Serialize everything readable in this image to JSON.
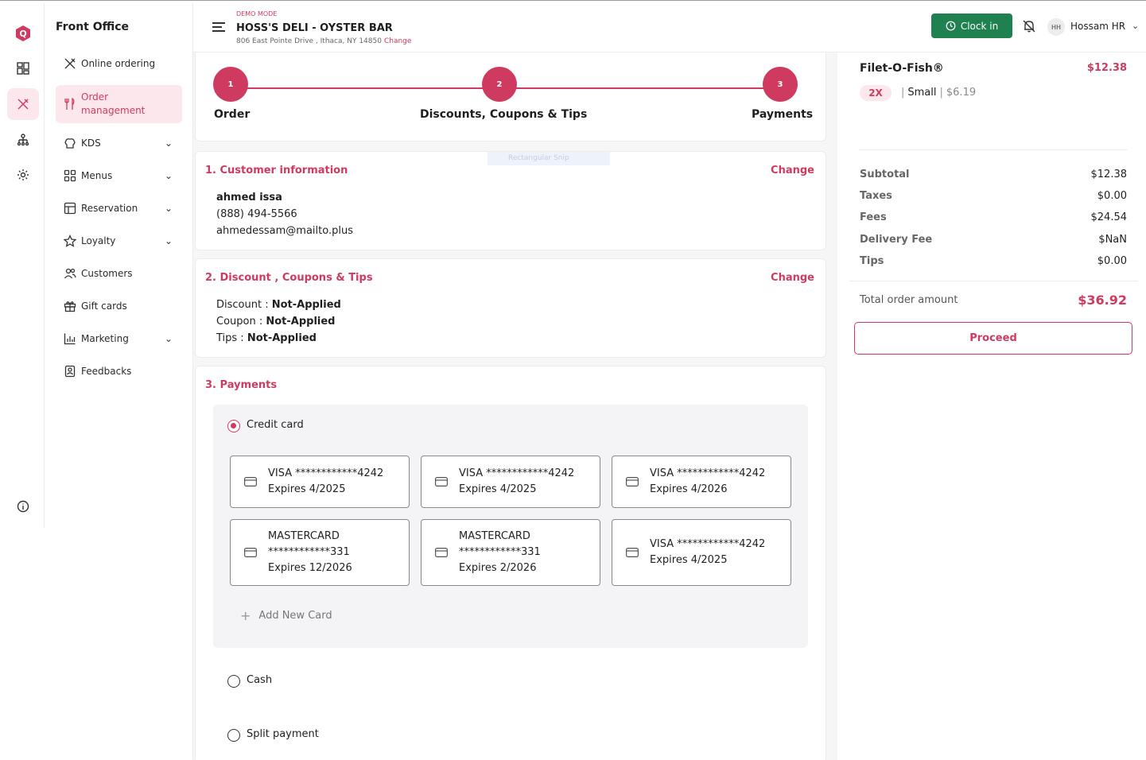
{
  "sidebar": {
    "title": "Front Office",
    "items": [
      {
        "label": "Online ordering",
        "icon": "utensils-icon"
      },
      {
        "label": "Order management",
        "icon": "fork-knife-icon"
      },
      {
        "label": "KDS",
        "icon": "chef-hat-icon"
      },
      {
        "label": "Menus",
        "icon": "grid-icon"
      },
      {
        "label": "Reservation",
        "icon": "table-icon"
      },
      {
        "label": "Loyalty",
        "icon": "star-icon"
      },
      {
        "label": "Customers",
        "icon": "users-icon"
      },
      {
        "label": "Gift cards",
        "icon": "gift-icon"
      },
      {
        "label": "Marketing",
        "icon": "chart-icon"
      },
      {
        "label": "Feedbacks",
        "icon": "feedback-icon"
      }
    ]
  },
  "header": {
    "demo_label": "DEMO MODE",
    "store_name": "HOSS'S DELI - OYSTER BAR",
    "address": "806 East Pointe Drive , Ithaca, NY 14850",
    "change_label": "Change",
    "clockin_label": "Clock in",
    "user_initials": "HH",
    "user_name": "Hossam HR"
  },
  "stepper": {
    "steps": [
      {
        "number": "1",
        "label": "Order"
      },
      {
        "number": "2",
        "label": "Discounts, Coupons & Tips"
      },
      {
        "number": "3",
        "label": "Payments"
      }
    ]
  },
  "ghost_label": "Rectangular Snip",
  "customer": {
    "title": "1. Customer information",
    "change_label": "Change",
    "name": "ahmed issa",
    "phone": "(888) 494-5566",
    "email": "ahmedessam@mailto.plus"
  },
  "discounts": {
    "title": "2. Discount , Coupons & Tips",
    "change_label": "Change",
    "discount_key": "Discount : ",
    "discount_val": "Not-Applied",
    "coupon_key": "Coupon : ",
    "coupon_val": "Not-Applied",
    "tips_key": "Tips : ",
    "tips_val": "Not-Applied"
  },
  "payments": {
    "title": "3. Payments",
    "credit_label": "Credit card",
    "cards": [
      {
        "line1": "VISA ************4242",
        "line2": "Expires 4/2025"
      },
      {
        "line1": "VISA ************4242",
        "line2": "Expires 4/2025"
      },
      {
        "line1": "VISA ************4242",
        "line2": "Expires 4/2026"
      },
      {
        "line1": "MASTERCARD",
        "line1b": "************331",
        "line2": "Expires 12/2026"
      },
      {
        "line1": "MASTERCARD",
        "line1b": "************331",
        "line2": "Expires 2/2026"
      },
      {
        "line1": "VISA ************4242",
        "line2": "Expires 4/2025"
      }
    ],
    "add_card_label": "Add New Card",
    "cash_label": "Cash",
    "split_label": "Split payment"
  },
  "summary": {
    "item_name": "Filet-O-Fish®",
    "item_price": "$12.38",
    "qty": "2X",
    "size": "Small",
    "unit_price": "$6.19",
    "rows": [
      {
        "k": "Subtotal",
        "v": "$12.38"
      },
      {
        "k": "Taxes",
        "v": "$0.00"
      },
      {
        "k": "Fees",
        "v": "$24.54"
      },
      {
        "k": "Delivery Fee",
        "v": "$NaN"
      },
      {
        "k": "Tips",
        "v": "$0.00"
      }
    ],
    "total_label": "Total order amount",
    "total_value": "$36.92",
    "proceed_label": "Proceed"
  },
  "colors": {
    "accent": "#cf3b60",
    "clockin": "#1f8150"
  }
}
